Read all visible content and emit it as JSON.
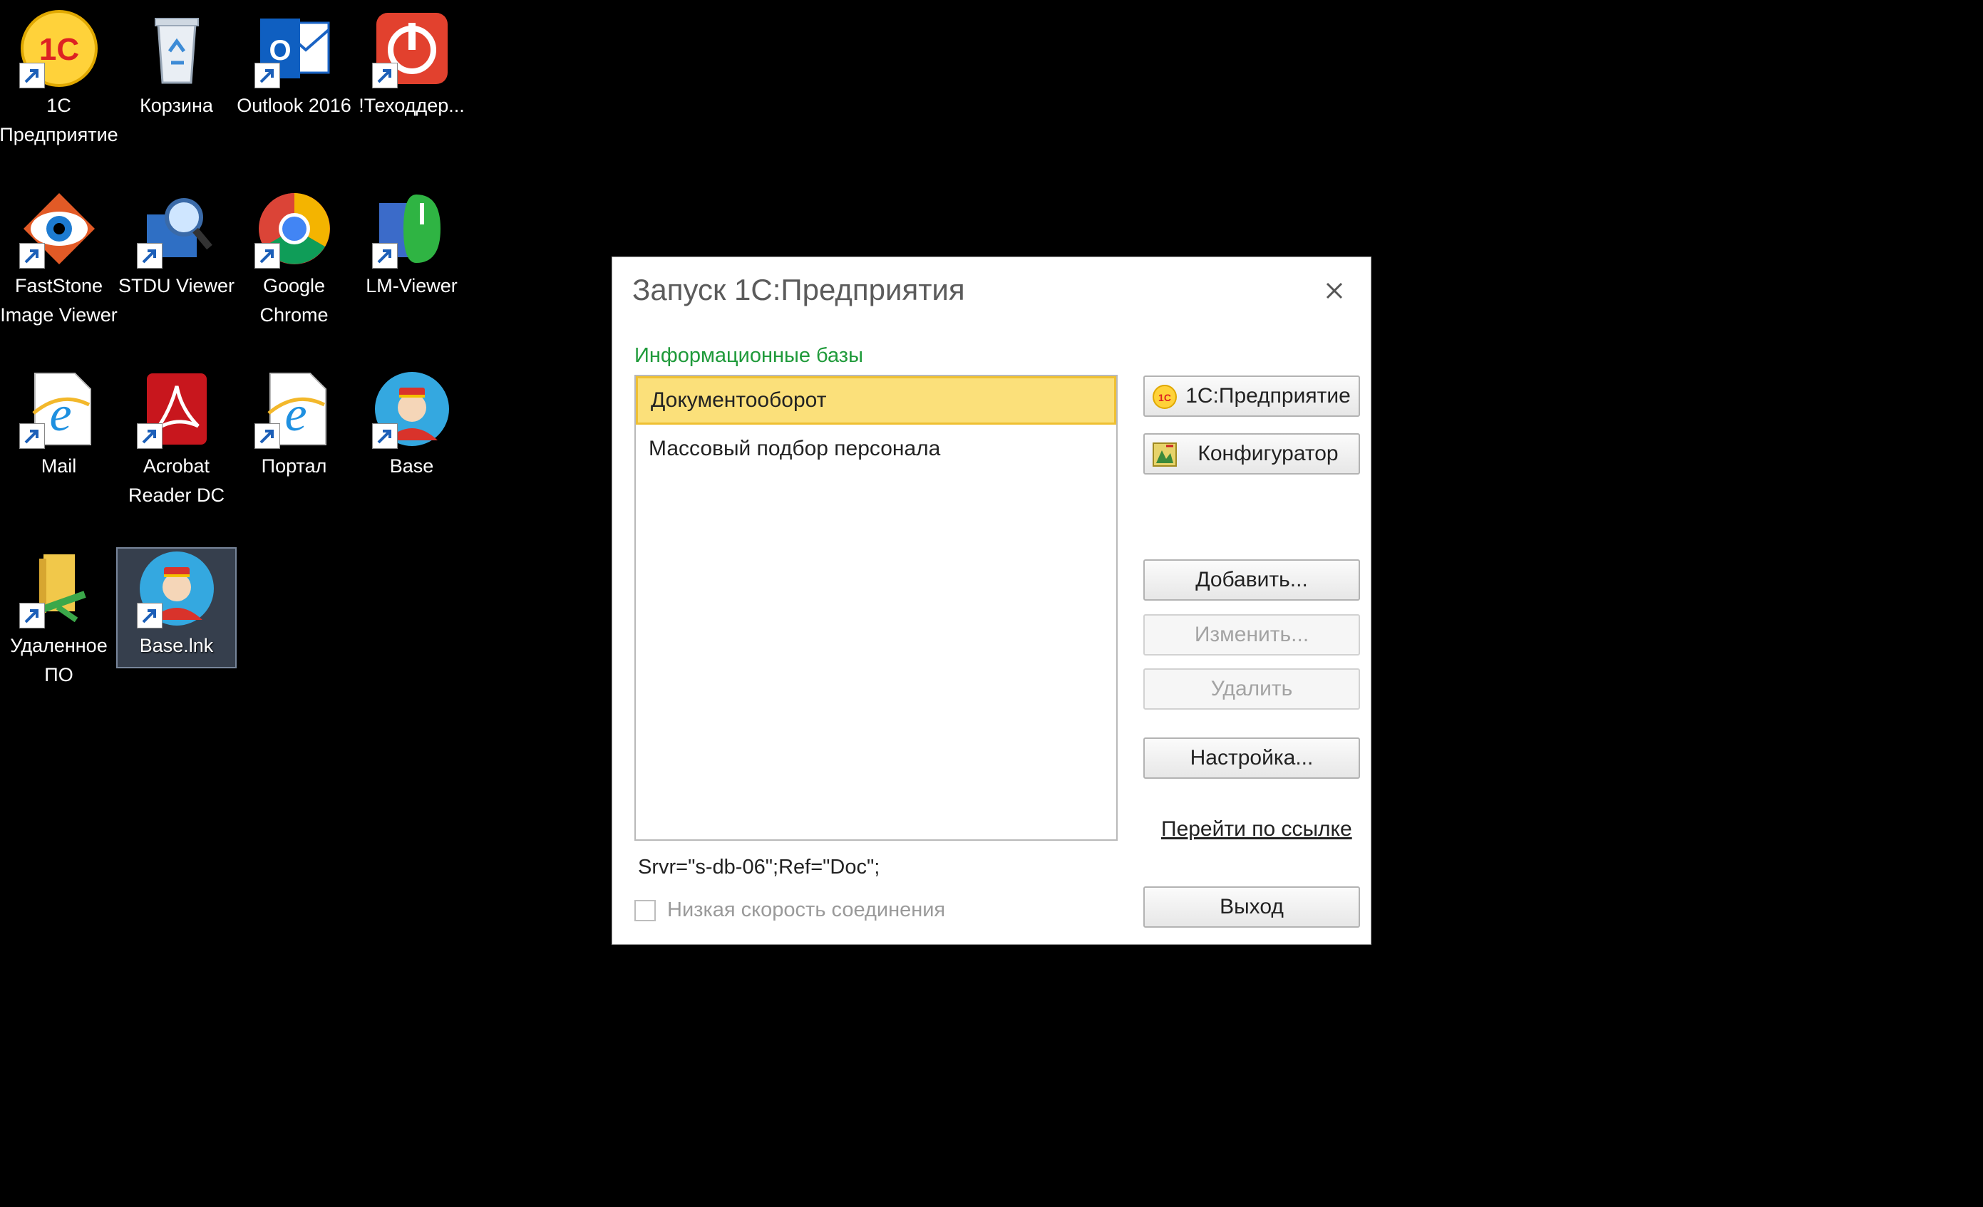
{
  "desktop": {
    "icons": [
      {
        "label": "1С\nПредприятие",
        "icon": "1c-icon"
      },
      {
        "label": "Корзина",
        "icon": "recycle-bin-icon"
      },
      {
        "label": "Outlook 2016",
        "icon": "outlook-icon"
      },
      {
        "label": "!Теходдер...",
        "icon": "support-power-icon"
      },
      {
        "label": "FastStone\nImage Viewer",
        "icon": "faststone-eye-icon"
      },
      {
        "label": "STDU Viewer",
        "icon": "stdu-magnifier-icon"
      },
      {
        "label": "Google\nChrome",
        "icon": "chrome-icon"
      },
      {
        "label": "LM-Viewer",
        "icon": "lm-viewer-icon"
      },
      {
        "label": "Mail",
        "icon": "ie-mail-icon"
      },
      {
        "label": "Acrobat\nReader DC",
        "icon": "acrobat-icon"
      },
      {
        "label": "Портал",
        "icon": "ie-portal-icon"
      },
      {
        "label": "Base",
        "icon": "base-bellhop-icon"
      },
      {
        "label": "Удаленное\nПО",
        "icon": "remote-folder-icon"
      },
      {
        "label": "Base.lnk",
        "icon": "base-bellhop-icon",
        "selected": true
      }
    ]
  },
  "dialog": {
    "title": "Запуск 1С:Предприятия",
    "section_label": "Информационные базы",
    "infobases": [
      {
        "name": "Документооборот",
        "selected": true
      },
      {
        "name": "Массовый подбор персонала",
        "selected": false
      }
    ],
    "buttons": {
      "enterprise": "1С:Предприятие",
      "configurator": "Конфигуратор",
      "add": "Добавить...",
      "edit": "Изменить...",
      "delete": "Удалить",
      "settings": "Настройка...",
      "exit": "Выход"
    },
    "link": "Перейти по ссылке",
    "connection_string": "Srvr=\"s-db-06\";Ref=\"Doc\";",
    "low_speed_label": "Низкая скорость соединения",
    "low_speed_checked": false
  },
  "colors": {
    "accent_green": "#1f9a3a",
    "selection_yellow": "#fbe07a"
  }
}
